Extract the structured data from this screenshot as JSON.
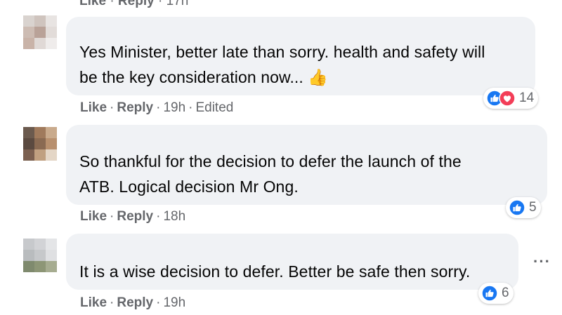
{
  "top_partial": {
    "like": "Like",
    "reply": "Reply",
    "time": "17h"
  },
  "comments": [
    {
      "text_line1": "Yes Minister, better late than sorry. health and safety will",
      "text_line2": "be the key consideration now... 👍",
      "like": "Like",
      "reply": "Reply",
      "time": "19h",
      "edited": "Edited",
      "reaction_count": "14",
      "reaction_icons": [
        "like-icon",
        "love-icon"
      ]
    },
    {
      "text_line1": "So thankful for the decision to defer the launch of the",
      "text_line2": "ATB. Logical decision Mr Ong.",
      "like": "Like",
      "reply": "Reply",
      "time": "18h",
      "reaction_count": "5",
      "reaction_icons": [
        "like-icon"
      ]
    },
    {
      "text_line1": "It is a wise decision to defer. Better be safe then sorry.",
      "like": "Like",
      "reply": "Reply",
      "time": "19h",
      "reaction_count": "6",
      "reaction_icons": [
        "like-icon"
      ],
      "more_options": "···"
    }
  ],
  "colors": {
    "bubble": "#f0f2f5",
    "meta_text": "#65676b",
    "like_blue": "#1877f2",
    "love_red": "#f33e58"
  }
}
